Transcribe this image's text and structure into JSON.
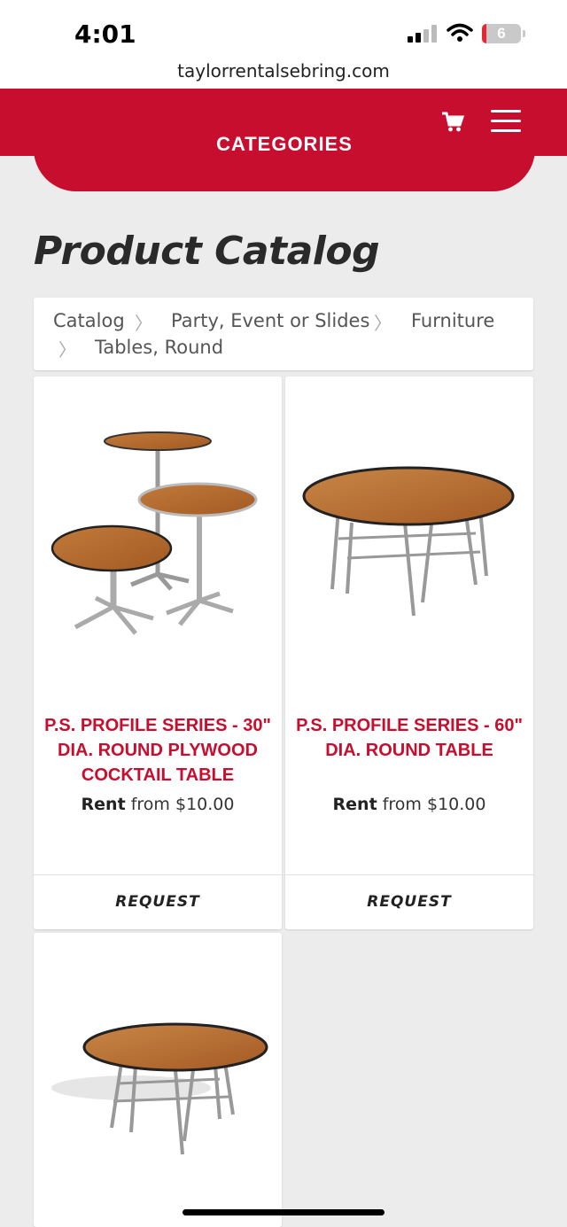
{
  "status": {
    "time": "4:01",
    "url": "taylorrentalsebring.com",
    "battery": "6"
  },
  "header": {
    "categories_label": "CATEGORIES",
    "cart_icon": "cart-icon",
    "menu_icon": "hamburger-menu-icon",
    "brand_color": "#c70e2e"
  },
  "page_title": "Product Catalog",
  "breadcrumb": [
    "Catalog",
    "Party, Event or Slides",
    "Furniture",
    "Tables, Round"
  ],
  "products": [
    {
      "title": "P.S. PROFILE SERIES - 30\" DIA. ROUND PLYWOOD COCKTAIL TABLE",
      "price_prefix": "Rent",
      "price_text": "from $10.00",
      "button": "REQUEST"
    },
    {
      "title": "P.S. PROFILE SERIES - 60\" DIA. ROUND TABLE",
      "price_prefix": "Rent",
      "price_text": "from $10.00",
      "button": "REQUEST"
    },
    {
      "title": "",
      "price_prefix": "",
      "price_text": "",
      "button": ""
    }
  ]
}
